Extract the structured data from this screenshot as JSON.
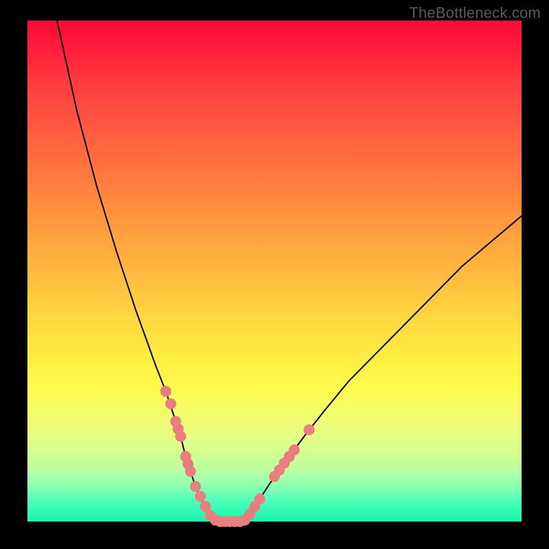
{
  "watermark": "TheBottleneck.com",
  "colors": {
    "frame": "#000000",
    "curve": "#000000",
    "dot": "#e97e7e",
    "gradient_top": "#ff0a3a",
    "gradient_bottom": "#16f7ae"
  },
  "chart_data": {
    "type": "line",
    "title": "",
    "xlabel": "",
    "ylabel": "",
    "xlim": [
      0,
      100
    ],
    "ylim": [
      0,
      100
    ],
    "grid": false,
    "legend": "none",
    "notes": "V-shaped bottleneck curve with minimum near x≈38; y is mismatch/bottleneck % where 0 (bottom/green) is ideal and 100 (top/red) is worst. Pink dots cluster on both branches near the minimum.",
    "series": [
      {
        "name": "left_branch",
        "x": [
          6,
          10,
          14,
          18,
          22,
          26,
          28,
          30,
          31,
          32,
          33,
          34,
          35,
          36,
          37,
          38
        ],
        "y": [
          100,
          82,
          67,
          54,
          42,
          31,
          26,
          20,
          17,
          13,
          10,
          7,
          5,
          3,
          1,
          0
        ]
      },
      {
        "name": "flat_min",
        "x": [
          38,
          39,
          40,
          41,
          42,
          43,
          44
        ],
        "y": [
          0,
          0,
          0,
          0,
          0,
          0,
          0
        ]
      },
      {
        "name": "right_branch",
        "x": [
          44,
          46,
          48,
          50,
          53,
          56,
          60,
          65,
          70,
          76,
          82,
          88,
          94,
          100
        ],
        "y": [
          0,
          3,
          6,
          9,
          13,
          17,
          22,
          28,
          33,
          39,
          45,
          51,
          56,
          61
        ]
      }
    ],
    "dots": [
      {
        "x": 28.0,
        "y": 26.0
      },
      {
        "x": 29.0,
        "y": 23.5
      },
      {
        "x": 30.0,
        "y": 20.0
      },
      {
        "x": 30.5,
        "y": 18.5
      },
      {
        "x": 31.0,
        "y": 17.0
      },
      {
        "x": 32.0,
        "y": 13.0
      },
      {
        "x": 32.5,
        "y": 11.5
      },
      {
        "x": 33.0,
        "y": 10.0
      },
      {
        "x": 34.0,
        "y": 7.0
      },
      {
        "x": 35.0,
        "y": 5.0
      },
      {
        "x": 36.0,
        "y": 3.0
      },
      {
        "x": 37.0,
        "y": 1.2
      },
      {
        "x": 38.0,
        "y": 0.3
      },
      {
        "x": 39.0,
        "y": 0.0
      },
      {
        "x": 40.0,
        "y": 0.0
      },
      {
        "x": 41.0,
        "y": 0.0
      },
      {
        "x": 42.0,
        "y": 0.0
      },
      {
        "x": 43.0,
        "y": 0.0
      },
      {
        "x": 44.0,
        "y": 0.3
      },
      {
        "x": 45.0,
        "y": 1.5
      },
      {
        "x": 46.0,
        "y": 3.0
      },
      {
        "x": 47.0,
        "y": 4.5
      },
      {
        "x": 50.0,
        "y": 9.0
      },
      {
        "x": 51.0,
        "y": 10.3
      },
      {
        "x": 52.0,
        "y": 11.7
      },
      {
        "x": 53.0,
        "y": 13.0
      },
      {
        "x": 54.0,
        "y": 14.3
      },
      {
        "x": 57.0,
        "y": 18.3
      }
    ]
  }
}
